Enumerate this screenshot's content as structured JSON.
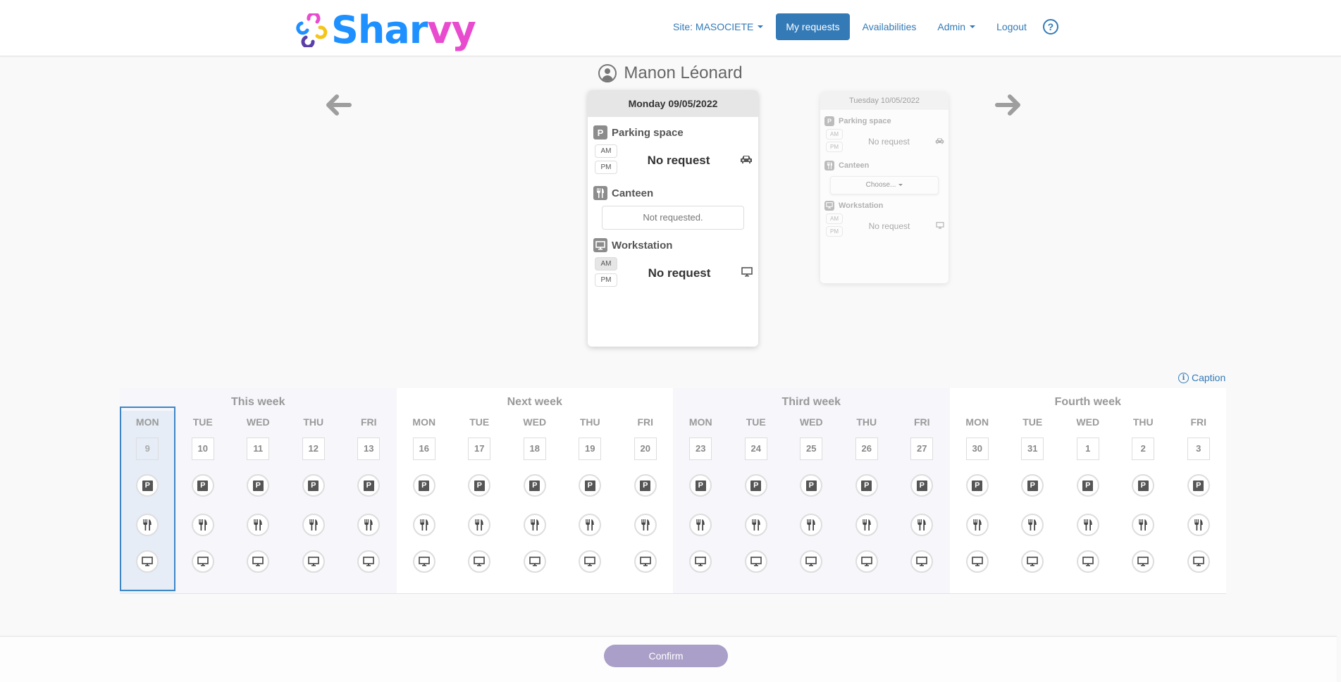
{
  "app": {
    "logo": {
      "part1": "Shar",
      "part2": "vy"
    },
    "colors": {
      "brand_blue": "#1e90ff",
      "brand_pink": "#e94bcf",
      "nav_link": "#337ab7",
      "confirm": "#aa9fc8",
      "today_border": "#3d85c6"
    }
  },
  "nav": {
    "site": "Site: MASOCIETE",
    "my_requests": "My requests",
    "availabilities": "Availabilities",
    "admin": "Admin",
    "logout": "Logout",
    "help": "?"
  },
  "user": {
    "name": "Manon Léonard"
  },
  "icons": {
    "prev": "arrow-left-icon",
    "next": "arrow-right-icon",
    "parking": "parking-icon",
    "canteen": "fork-knife-icon",
    "workstation": "monitor-icon",
    "car": "car-icon",
    "info": "info-icon"
  },
  "current_day": {
    "title": "Monday 09/05/2022",
    "parking": {
      "label": "Parking space",
      "am": "AM",
      "pm": "PM",
      "status": "No request"
    },
    "canteen": {
      "label": "Canteen",
      "value": "Not requested."
    },
    "workstation": {
      "label": "Workstation",
      "am": "AM",
      "pm": "PM",
      "status": "No request"
    }
  },
  "next_day": {
    "title": "Tuesday 10/05/2022",
    "parking": {
      "label": "Parking space",
      "am": "AM",
      "pm": "PM",
      "status": "No request"
    },
    "canteen": {
      "label": "Canteen",
      "value": "Choose..."
    },
    "workstation": {
      "label": "Workstation",
      "am": "AM",
      "pm": "PM",
      "status": "No request"
    }
  },
  "caption": {
    "label": "Caption",
    "icon_glyph": "i"
  },
  "service_glyphs": {
    "parking": "P"
  },
  "weeks": [
    {
      "title": "This week",
      "days": [
        {
          "name": "MON",
          "num": "9"
        },
        {
          "name": "TUE",
          "num": "10"
        },
        {
          "name": "WED",
          "num": "11"
        },
        {
          "name": "THU",
          "num": "12"
        },
        {
          "name": "FRI",
          "num": "13"
        }
      ]
    },
    {
      "title": "Next week",
      "days": [
        {
          "name": "MON",
          "num": "16"
        },
        {
          "name": "TUE",
          "num": "17"
        },
        {
          "name": "WED",
          "num": "18"
        },
        {
          "name": "THU",
          "num": "19"
        },
        {
          "name": "FRI",
          "num": "20"
        }
      ]
    },
    {
      "title": "Third week",
      "days": [
        {
          "name": "MON",
          "num": "23"
        },
        {
          "name": "TUE",
          "num": "24"
        },
        {
          "name": "WED",
          "num": "25"
        },
        {
          "name": "THU",
          "num": "26"
        },
        {
          "name": "FRI",
          "num": "27"
        }
      ]
    },
    {
      "title": "Fourth week",
      "days": [
        {
          "name": "MON",
          "num": "30"
        },
        {
          "name": "TUE",
          "num": "31"
        },
        {
          "name": "WED",
          "num": "1"
        },
        {
          "name": "THU",
          "num": "2"
        },
        {
          "name": "FRI",
          "num": "3"
        }
      ]
    }
  ],
  "selected": {
    "week": 0,
    "day": 0
  },
  "footer": {
    "confirm": "Confirm"
  }
}
